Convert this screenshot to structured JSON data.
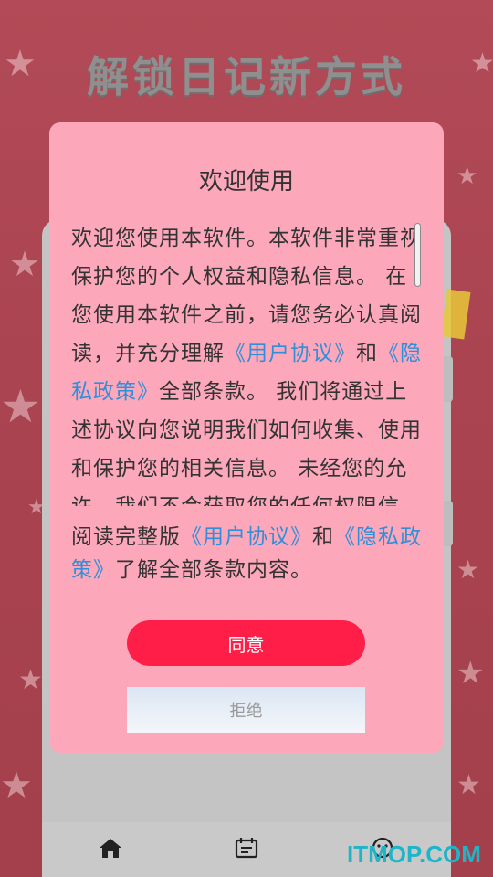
{
  "background": {
    "title": "解锁日记新方式",
    "nav": [
      "home-icon",
      "calendar-icon",
      "mood-icon"
    ]
  },
  "dialog": {
    "title": "欢迎使用",
    "body": {
      "p1": "欢迎您使用本软件。本软件非常重视保护您的个人权益和隐私信息。 在您使用本软件之前，请您务必认真阅读，并充分理解",
      "link1": "《用户协议》",
      "p2": "和",
      "link2": "《隐私政策》",
      "p3": "全部条款。 我们将通过上述协议向您说明我们如何收集、使用和保护您的相关信息。 未经您的允许，我们不会获取您的任何权限信"
    },
    "footer": {
      "prefix": "阅读完整版",
      "link1": "《用户协议》",
      "mid": "和",
      "link2": "《隐私政策》",
      "suffix": "了解全部条款内容。"
    },
    "agree_label": "同意",
    "reject_label": "拒绝"
  },
  "watermark": "ITMOP.COM",
  "colors": {
    "background": "#a9434f",
    "dialog": "#fda7bb",
    "agree": "#ff1e48",
    "link": "#2f8fd8"
  }
}
